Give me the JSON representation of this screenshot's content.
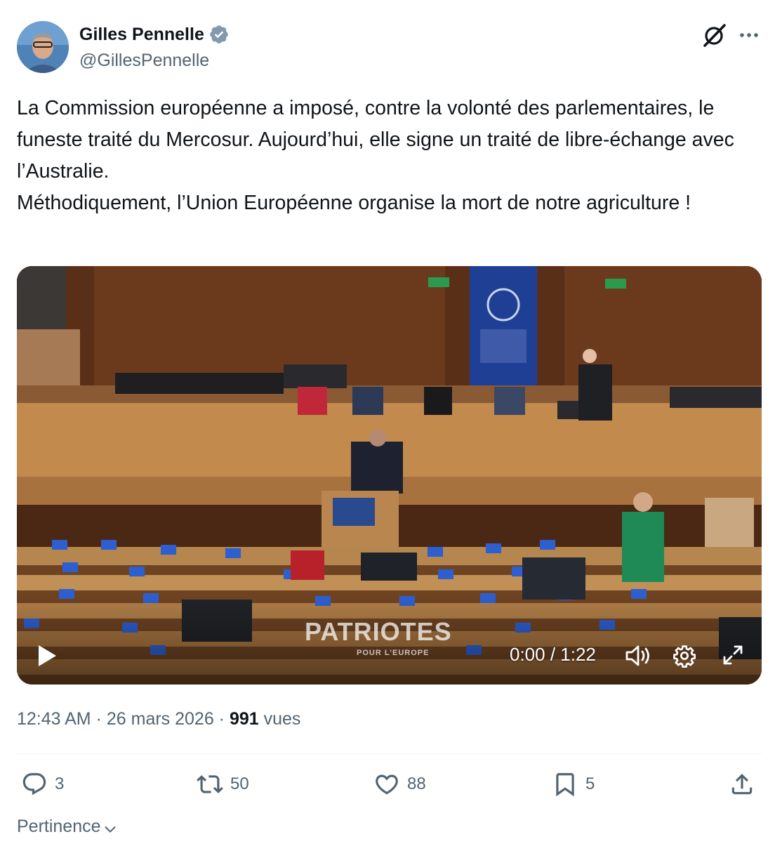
{
  "author": {
    "display_name": "Gilles Pennelle",
    "handle": "@GillesPennelle",
    "verified": true
  },
  "icons": {
    "verified": "verified-badge-icon",
    "grok": "grok-icon",
    "more": "more-icon",
    "play": "play-icon",
    "volume": "volume-icon",
    "settings": "gear-icon",
    "fullscreen": "fullscreen-icon",
    "reply": "reply-icon",
    "repost": "repost-icon",
    "like": "heart-icon",
    "bookmark": "bookmark-icon",
    "share": "share-icon",
    "chevron": "chevron-down-icon"
  },
  "tweet": {
    "text": "La Commission européenne a imposé, contre la volonté des parlementaires, le funeste traité du Mercosur. Aujourd’hui, elle signe un traité de libre-échange avec l’Australie.\nMéthodiquement, l’Union Européenne organise la mort de notre agriculture !"
  },
  "video": {
    "watermark": "PATRIOTES",
    "watermark_sub": "POUR L’EUROPE",
    "time": "0:00 / 1:22"
  },
  "meta": {
    "time": "12:43 AM",
    "separator1": " · ",
    "date": "26 mars 2026",
    "separator2": " · ",
    "views_count": "991",
    "views_label": " vues"
  },
  "actions": {
    "replies": "3",
    "reposts": "50",
    "likes": "88",
    "bookmarks": "5"
  },
  "sort": {
    "label": "Pertinence"
  },
  "colors": {
    "text": "#0f1419",
    "secondary": "#536471",
    "verified": "#829aab",
    "divider": "#eff3f4"
  }
}
